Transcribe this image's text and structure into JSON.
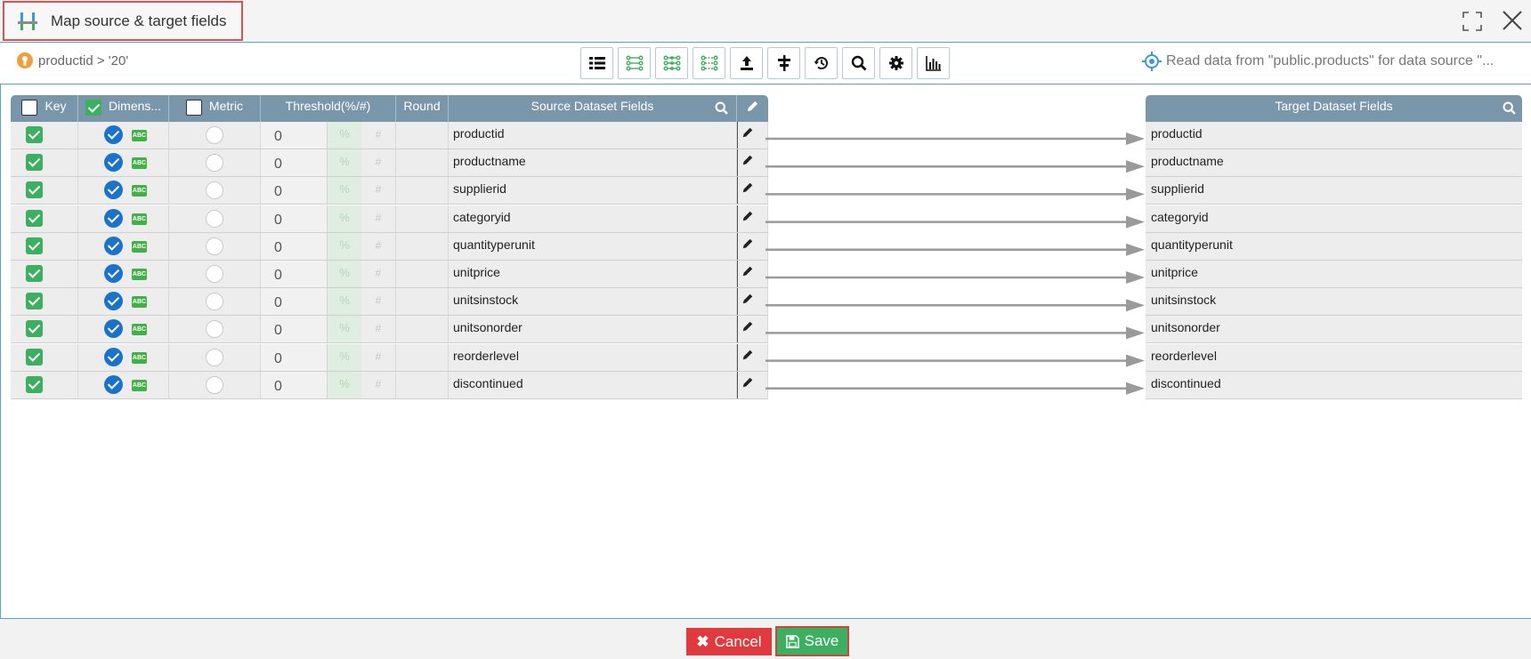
{
  "window": {
    "title": "Map source & target fields"
  },
  "toolbar": {
    "filter_text": "productid > '20'",
    "status_text": "Read data from \"public.products\" for data source \"...",
    "buttons": [
      {
        "name": "list-view-button",
        "icon": "list-icon"
      },
      {
        "name": "map-by-name-button",
        "icon": "map-fields-icon"
      },
      {
        "name": "map-by-position-button",
        "icon": "map-position-icon"
      },
      {
        "name": "map-by-order-button",
        "icon": "map-order-icon"
      },
      {
        "name": "upload-button",
        "icon": "upload-icon"
      },
      {
        "name": "align-button",
        "icon": "align-icon"
      },
      {
        "name": "reset-button",
        "icon": "history-icon"
      },
      {
        "name": "search-button",
        "icon": "search-icon"
      },
      {
        "name": "settings-button",
        "icon": "gear-icon"
      },
      {
        "name": "chart-button",
        "icon": "bar-chart-icon"
      }
    ]
  },
  "grid": {
    "columns": {
      "key": "Key",
      "dimension": "Dimens...",
      "metric": "Metric",
      "threshold": "Threshold(%/#)",
      "round": "Round",
      "source": "Source Dataset Fields"
    },
    "header_checks": {
      "key": false,
      "dimension": true,
      "metric": false
    },
    "percent_symbol": "%",
    "hash_symbol": "#",
    "type_badge": "ABC",
    "rows": [
      {
        "field": "productid",
        "key": true,
        "dimension": true,
        "metric": false,
        "threshold": "0"
      },
      {
        "field": "productname",
        "key": true,
        "dimension": true,
        "metric": false,
        "threshold": "0"
      },
      {
        "field": "supplierid",
        "key": true,
        "dimension": true,
        "metric": false,
        "threshold": "0"
      },
      {
        "field": "categoryid",
        "key": true,
        "dimension": true,
        "metric": false,
        "threshold": "0"
      },
      {
        "field": "quantityperunit",
        "key": true,
        "dimension": true,
        "metric": false,
        "threshold": "0"
      },
      {
        "field": "unitprice",
        "key": true,
        "dimension": true,
        "metric": false,
        "threshold": "0"
      },
      {
        "field": "unitsinstock",
        "key": true,
        "dimension": true,
        "metric": false,
        "threshold": "0"
      },
      {
        "field": "unitsonorder",
        "key": true,
        "dimension": true,
        "metric": false,
        "threshold": "0"
      },
      {
        "field": "reorderlevel",
        "key": true,
        "dimension": true,
        "metric": false,
        "threshold": "0"
      },
      {
        "field": "discontinued",
        "key": true,
        "dimension": true,
        "metric": false,
        "threshold": "0"
      }
    ]
  },
  "target": {
    "header": "Target Dataset Fields",
    "fields": [
      "productid",
      "productname",
      "supplierid",
      "categoryid",
      "quantityperunit",
      "unitprice",
      "unitsinstock",
      "unitsonorder",
      "reorderlevel",
      "discontinued"
    ]
  },
  "footer": {
    "cancel_label": "Cancel",
    "save_label": "Save"
  },
  "colors": {
    "header_bg": "#7a96ab",
    "accent_blue": "#5aa2d0",
    "check_green": "#3cb060",
    "dimension_blue": "#1a73c9",
    "cancel_red": "#e0393e",
    "save_green": "#3cb060"
  }
}
